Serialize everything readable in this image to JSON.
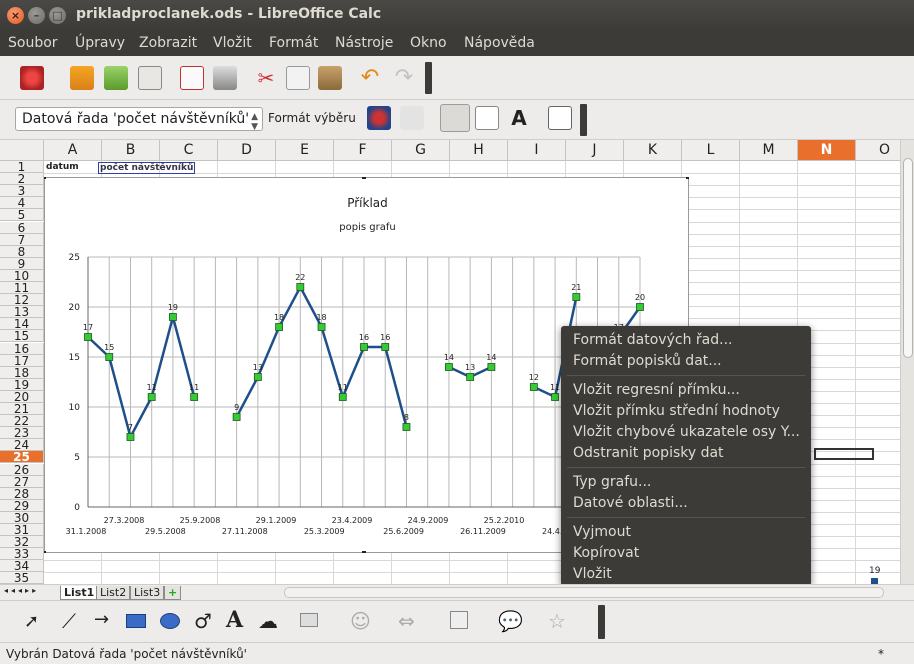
{
  "window": {
    "title": "prikladproclanek.ods - LibreOffice Calc"
  },
  "menu": [
    "Soubor",
    "Úpravy",
    "Zobrazit",
    "Vložit",
    "Formát",
    "Nástroje",
    "Okno",
    "Nápověda"
  ],
  "formatting": {
    "series_select": "Datová řada  'počet návštěvníků'",
    "format_selection": "Formát výběru"
  },
  "columns": [
    "A",
    "B",
    "C",
    "D",
    "E",
    "F",
    "G",
    "H",
    "I",
    "J",
    "K",
    "L",
    "M",
    "N",
    "O"
  ],
  "selected_column": "N",
  "rows": [
    "1",
    "2",
    "3",
    "4",
    "5",
    "6",
    "7",
    "8",
    "9",
    "10",
    "11",
    "12",
    "13",
    "14",
    "15",
    "16",
    "17",
    "18",
    "19",
    "20",
    "21",
    "22",
    "23",
    "24",
    "25",
    "26",
    "27",
    "28",
    "29",
    "30",
    "31",
    "32",
    "33",
    "34",
    "35"
  ],
  "selected_row": "25",
  "cells": {
    "a1": "datum",
    "b1": "počet návštěvníků",
    "n35_value": "19"
  },
  "chart_data": {
    "type": "line",
    "title": "Příklad",
    "subtitle": "popis grafu",
    "ylim": [
      0,
      25
    ],
    "yticks": [
      "25",
      "20",
      "15",
      "10",
      "5",
      "0"
    ],
    "xtick_labels_top": [
      "27.3.2008",
      "25.9.2008",
      "29.1.2009",
      "23.4.2009",
      "24.9.2009",
      "25.2.2010",
      "24.8"
    ],
    "xtick_labels_bottom": [
      "31.1.2008",
      "29.5.2008",
      "27.11.2008",
      "25.3.2009",
      "25.6.2009",
      "26.11.2009",
      "24.4.2010"
    ],
    "segments": [
      [
        17,
        15,
        7,
        11,
        19,
        11
      ],
      [
        9,
        13,
        18,
        22,
        18,
        11,
        16,
        16,
        8
      ],
      [
        14,
        13,
        14
      ],
      [
        12,
        11,
        21
      ],
      [
        17,
        20
      ]
    ],
    "series_color": "#1f4f8a",
    "marker_color": "#33cc33"
  },
  "context_menu": {
    "groups": [
      [
        "Formát datových řad...",
        "Formát popisků dat..."
      ],
      [
        "Vložit regresní přímku...",
        "Vložit přímku střední hodnoty",
        "Vložit chybové ukazatele osy Y...",
        "Odstranit popisky dat"
      ],
      [
        "Typ grafu...",
        "Datové oblasti..."
      ],
      [
        "Vyjmout",
        "Kopírovat",
        "Vložit"
      ]
    ]
  },
  "sheet_tabs": [
    "List1",
    "List2",
    "List3"
  ],
  "active_sheet": "List1",
  "status": {
    "text": "Vybrán Datová řada  'počet návštěvníků'",
    "modified": "*"
  }
}
